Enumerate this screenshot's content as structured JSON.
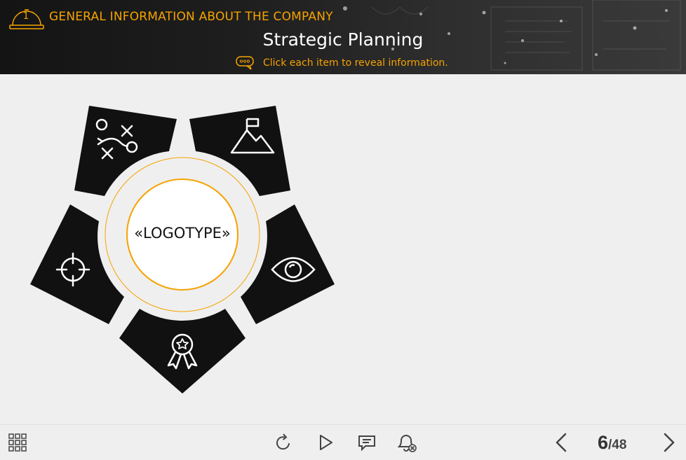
{
  "header": {
    "section_number": "1",
    "section_title": "GENERAL INFORMATION ABOUT THE COMPANY",
    "page_title": "Strategic Planning",
    "instruction": "Click each item to reveal information.",
    "accent_color": "#f5a300"
  },
  "diagram": {
    "center_label": "«LOGOTYPE»",
    "segments": [
      {
        "name": "strategy",
        "icon": "strategy-plan-icon"
      },
      {
        "name": "goal",
        "icon": "mountain-flag-icon"
      },
      {
        "name": "vision",
        "icon": "eye-icon"
      },
      {
        "name": "values",
        "icon": "award-ribbon-icon"
      },
      {
        "name": "target",
        "icon": "crosshair-icon"
      }
    ]
  },
  "footer": {
    "current_page": "6",
    "total_pages": "/48",
    "icons": [
      "grid-menu-icon",
      "replay-icon",
      "play-icon",
      "comment-icon",
      "notification-off-icon",
      "prev-arrow-icon",
      "next-arrow-icon"
    ]
  }
}
